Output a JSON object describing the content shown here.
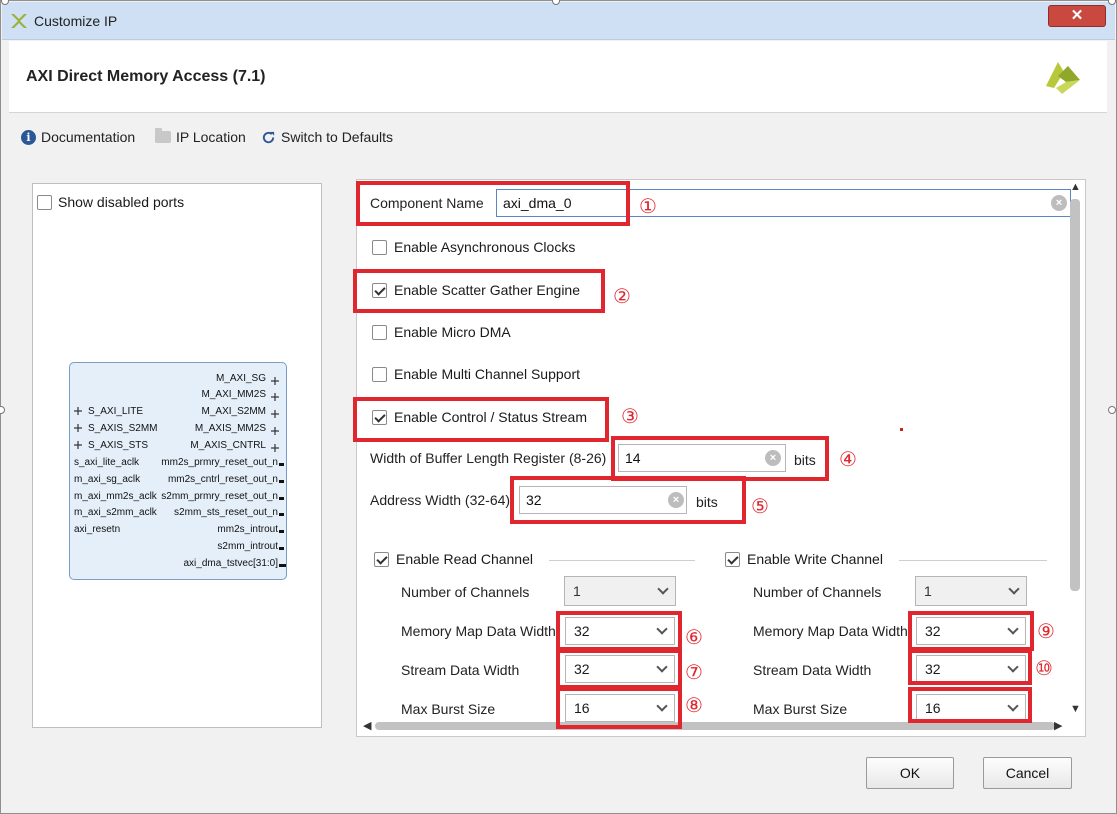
{
  "window": {
    "title": "Customize IP",
    "close_label": "✕"
  },
  "header": {
    "title": "AXI Direct Memory Access (7.1)"
  },
  "toolbar": {
    "documentation": "Documentation",
    "ip_location": "IP Location",
    "switch_defaults": "Switch to Defaults"
  },
  "left_panel": {
    "show_disabled_ports": "Show disabled ports",
    "show_disabled_checked": false,
    "ports_left": [
      "S_AXI_LITE",
      "S_AXIS_S2MM",
      "S_AXIS_STS",
      "s_axi_lite_aclk",
      "m_axi_sg_aclk",
      "m_axi_mm2s_aclk",
      "m_axi_s2mm_aclk",
      "axi_resetn"
    ],
    "ports_right": [
      "M_AXI_SG",
      "M_AXI_MM2S",
      "M_AXI_S2MM",
      "M_AXIS_MM2S",
      "M_AXIS_CNTRL",
      "mm2s_prmry_reset_out_n",
      "mm2s_cntrl_reset_out_n",
      "s2mm_prmry_reset_out_n",
      "s2mm_sts_reset_out_n",
      "mm2s_introut",
      "s2mm_introut",
      "axi_dma_tstvec[31:0]"
    ]
  },
  "config": {
    "component_name_label": "Component Name",
    "component_name_value": "axi_dma_0",
    "enable_async_clocks": "Enable Asynchronous Clocks",
    "enable_sg": "Enable Scatter Gather Engine",
    "enable_micro_dma": "Enable Micro DMA",
    "enable_multi_channel": "Enable Multi Channel Support",
    "enable_ctrl_status": "Enable Control / Status Stream",
    "buffer_len_label": "Width of Buffer Length Register (8-26)",
    "buffer_len_value": "14",
    "addr_width_label": "Address Width (32-64)",
    "addr_width_value": "32",
    "bits_unit": "bits",
    "checked": {
      "async": false,
      "sg": true,
      "micro": false,
      "multi": false,
      "ctrl": true,
      "read": true,
      "write": true
    }
  },
  "read_channel": {
    "label": "Enable Read Channel",
    "num_channels_label": "Number of Channels",
    "num_channels_value": "1",
    "mm_data_width_label": "Memory Map Data Width",
    "mm_data_width_value": "32",
    "stream_data_width_label": "Stream Data Width",
    "stream_data_width_value": "32",
    "max_burst_label": "Max Burst Size",
    "max_burst_value": "16"
  },
  "write_channel": {
    "label": "Enable Write Channel",
    "num_channels_label": "Number of Channels",
    "num_channels_value": "1",
    "mm_data_width_label": "Memory Map Data Width",
    "mm_data_width_value": "32",
    "stream_data_width_label": "Stream Data Width",
    "stream_data_width_value": "32",
    "max_burst_label": "Max Burst Size",
    "max_burst_value": "16"
  },
  "annotations": [
    "①",
    "②",
    "③",
    "④",
    "⑤",
    "⑥",
    "⑦",
    "⑧",
    "⑨",
    "⑩"
  ],
  "buttons": {
    "ok": "OK",
    "cancel": "Cancel"
  },
  "colors": {
    "annotation_red": "#e0262e",
    "titlebar": "#cfe0f4",
    "ip_block_fill": "#e5eff9"
  }
}
